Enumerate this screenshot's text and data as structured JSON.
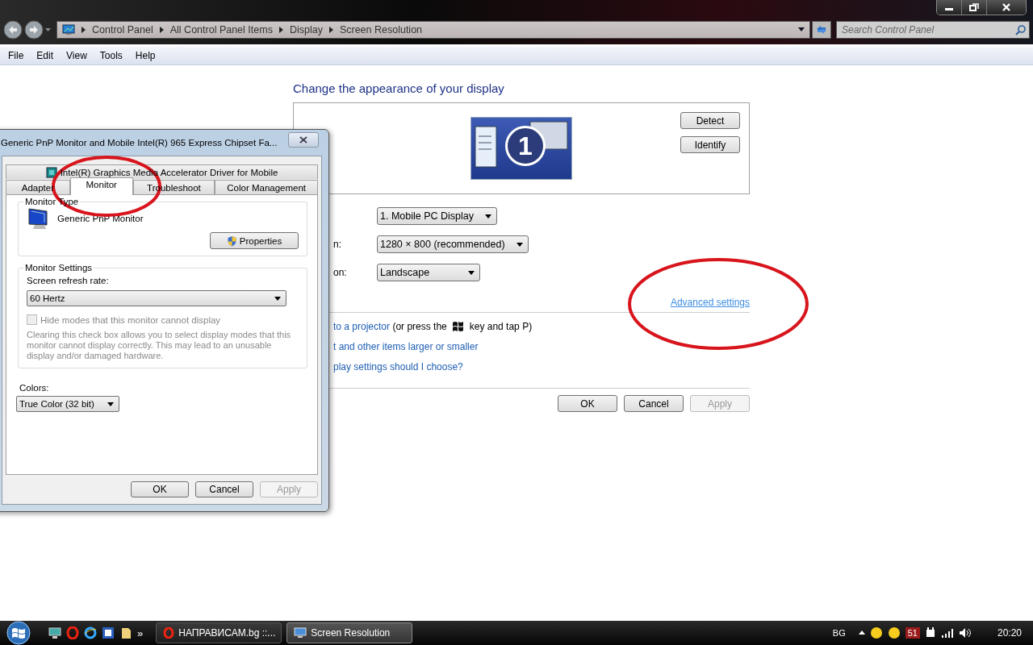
{
  "address_bar": {
    "breadcrumbs": [
      "Control Panel",
      "All Control Panel Items",
      "Display",
      "Screen Resolution"
    ],
    "search_placeholder": "Search Control Panel"
  },
  "menu": [
    "File",
    "Edit",
    "View",
    "Tools",
    "Help"
  ],
  "main": {
    "heading": "Change the appearance of your display",
    "preview_number": "1",
    "side_buttons": [
      "Detect",
      "Identify"
    ],
    "settings": [
      {
        "value": "1. Mobile PC Display"
      },
      {
        "label": "n:",
        "value": "1280 × 800 (recommended)"
      },
      {
        "label": "on:",
        "value": "Landscape"
      }
    ],
    "advanced_link": "Advanced settings",
    "projector": {
      "link": "to a projector",
      "before_key": "(or press the",
      "after_key": "key and tap P)"
    },
    "links": [
      "t and other items larger or smaller",
      "play settings should I choose?"
    ],
    "buttons": [
      {
        "label": "OK",
        "disabled": false
      },
      {
        "label": "Cancel",
        "disabled": false
      },
      {
        "label": "Apply",
        "disabled": true
      }
    ]
  },
  "dialog": {
    "title": "Generic PnP Monitor and Mobile Intel(R) 965 Express Chipset Fa...",
    "tab_rows": [
      [
        {
          "label": "Intel(R) Graphics Media Accelerator Driver for Mobile",
          "selected": false
        }
      ],
      [
        {
          "label": "Adapter",
          "selected": false
        },
        {
          "label": "Monitor",
          "selected": true
        },
        {
          "label": "Troubleshoot",
          "selected": false
        },
        {
          "label": "Color Management",
          "selected": false
        }
      ]
    ],
    "monitor_type": {
      "legend": "Monitor Type",
      "name": "Generic PnP Monitor",
      "button": "Properties"
    },
    "monitor_settings": {
      "legend": "Monitor Settings",
      "refresh_label": "Screen refresh rate:",
      "refresh_value": "60 Hertz",
      "checkbox": {
        "label": "Hide modes that this monitor cannot display",
        "checked": false,
        "disabled": true
      },
      "note": "Clearing this check box allows you to select display modes that this monitor cannot display correctly. This may lead to an unusable display and/or damaged hardware."
    },
    "colors_label": "Colors:",
    "colors_value": "True Color (32 bit)",
    "buttons": [
      {
        "label": "OK",
        "disabled": false
      },
      {
        "label": "Cancel",
        "disabled": false
      },
      {
        "label": "Apply",
        "disabled": true
      }
    ]
  },
  "taskbar": {
    "more": "»",
    "tasks": [
      {
        "label": "НАПРАВИСАМ.bg ::...",
        "kind": "browser",
        "selected": false
      },
      {
        "label": "Screen Resolution",
        "kind": "display",
        "selected": true
      }
    ],
    "language": "BG",
    "tray_badge": "51",
    "clock": "20:20"
  }
}
